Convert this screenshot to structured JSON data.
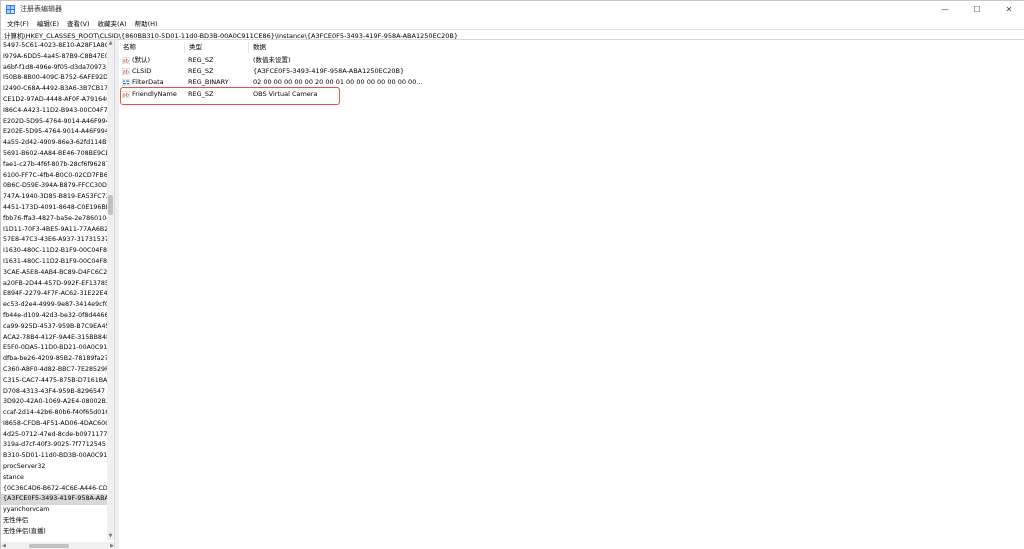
{
  "window": {
    "title": "注册表编辑器",
    "controls": {
      "minimize": "—",
      "maximize": "☐",
      "close": "✕"
    }
  },
  "menu": [
    "文件(F)",
    "编辑(E)",
    "查看(V)",
    "收藏夹(A)",
    "帮助(H)"
  ],
  "address": "计算机\\HKEY_CLASSES_ROOT\\CLSID\\{860BB310-5D01-11d0-BD3B-00A0C911CE86}\\Instance\\{A3FCE0F5-3493-419F-958A-ABA1250EC20B}",
  "tree": {
    "items": [
      "5497-5C61-4023-8E10-A28F1A8C06",
      "I979A-6DD5-4a45-87B9-C8B47E06",
      "a6bf-f1d8-496e-9f05-d3da70973",
      "I50B8-8B00-409C-B752-6AFE92D9",
      "I2490-C68A-4492-B3A6-3B7CB17F",
      "CE1D2-97AD-4448-AF0F-A7916407",
      "I86C4-A423-11D2-B943-00C04F79",
      "E202D-5D95-4764-9014-A46F994C",
      "E202E-5D95-4764-9014-A46F994C",
      "4a55-2d42-4909-86e3-62fd114B3",
      "5691-B602-4A84-BE46-708BE9CD",
      "fae1-c27b-4f6f-807b-28cf6f96287",
      "6100-FF7C-4fb4-B0C0-02CD7FB6",
      "0B6C-D59E-394A-B879-FFCC30DD",
      "747A-1940-3D85-B819-EA53FC73",
      "4451-173D-4091-8648-C0E196BB",
      "fbb76-ffa3-4827-ba5e-2e78601044",
      "I1D11-70F3-4BE5-9A11-77AA6B2E",
      "57E8-47C3-43E6-A937-31731537",
      "I1630-480C-11D2-B1F9-00C04F86",
      "I1631-480C-11D2-B1F9-00C04F86",
      "3CAE-A5E8-4AB4-BC89-D4FC6C2",
      "a20FB-2D44-457D-992F-EF13785D",
      "E894F-2279-4F7F-AC62-31E22E4D",
      "ec53-d2e4-4999-9e87-3414e9cf0f",
      "fb44e-d109-42d3-be32-0f8d4466",
      "ca99-925D-4537-959B-B7C9EA45",
      "ACA2-78B4-412F-9A4E-315BB848",
      "E5F0-0DA5-11D0-BD21-00A0C911",
      "dfba-be26-4209-85B2-78189fa27",
      "C360-A8F0-4d82-BBC7-7E28529F",
      "C315-CAC7-4475-875B-D7161BA7",
      "D708-4313-43F4-959B-8296547",
      "3D920-42A0-1069-A2E4-08002B3C",
      "ccaf-2d14-42b6-80b6-f40f65d016",
      "I8658-CFDB-4F51-AD06-4DAC60C",
      "4d25-0712-47ed-8cde-b0971177",
      "319a-d7cf-40f3-9025-7f7712545",
      "B310-5D01-11d0-BD3B-00A0C91",
      "procServer32",
      "stance",
      "{0C36C4D6-B672-4C6E-A446-CDE",
      "{A3FCE0F5-3493-419F-958A-ABA1",
      "yyanchorvcam",
      "无性伴侣",
      "无性伴侣(直播)"
    ],
    "selected_index": 42
  },
  "columns": {
    "name": "名称",
    "type": "类型",
    "data": "数据"
  },
  "values": [
    {
      "name": "(默认)",
      "type": "REG_SZ",
      "data": "(数值未设置)",
      "icon": "string-value-icon"
    },
    {
      "name": "CLSID",
      "type": "REG_SZ",
      "data": "{A3FCE0F5-3493-419F-958A-ABA1250EC20B}",
      "icon": "string-value-icon"
    },
    {
      "name": "FilterData",
      "type": "REG_BINARY",
      "data": "02 00 00 00 00 00 20 00 01 00 00 00 00 00 00 00...",
      "icon": "binary-value-icon"
    },
    {
      "name": "FriendlyName",
      "type": "REG_SZ",
      "data": "OBS Virtual Camera",
      "icon": "string-value-icon"
    }
  ],
  "highlight_color": "#e1553a",
  "selection_color": "#d9d9d9"
}
